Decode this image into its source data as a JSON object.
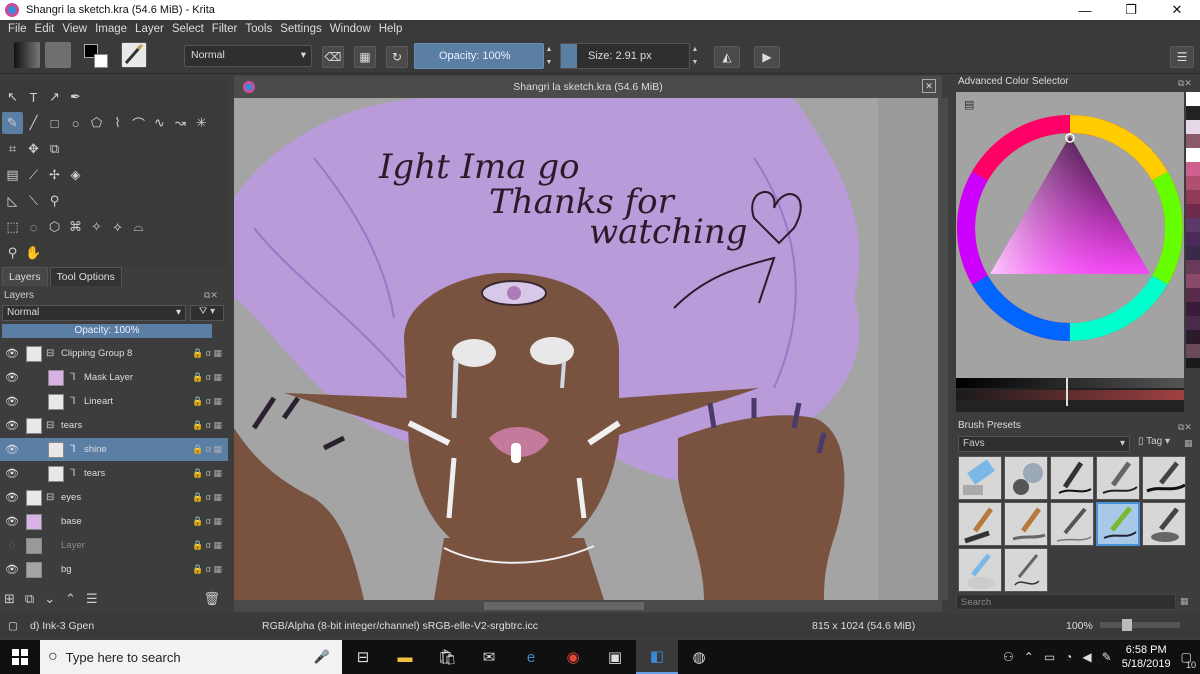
{
  "window": {
    "title": "Shangri la sketch.kra (54.6 MiB)  - Krita",
    "minimize": "—",
    "maximize": "❐",
    "close": "✕"
  },
  "menu": [
    "File",
    "Edit",
    "View",
    "Image",
    "Layer",
    "Select",
    "Filter",
    "Tools",
    "Settings",
    "Window",
    "Help"
  ],
  "toolbar": {
    "blend_mode": "Normal",
    "opacity_label": "Opacity:  100%",
    "size_label": "Size:  2.91 px"
  },
  "docker_tabs": [
    "Layers",
    "Tool Options"
  ],
  "layers": {
    "title": "Layers",
    "blend_mode": "Normal",
    "opacity_label": "Opacity:  100%",
    "items": [
      {
        "name": "Clipping Group 8",
        "visible": true,
        "selected": false,
        "dim": false
      },
      {
        "name": "Mask Layer",
        "visible": true,
        "selected": false,
        "dim": false
      },
      {
        "name": "Lineart",
        "visible": true,
        "selected": false,
        "dim": false
      },
      {
        "name": "tears",
        "visible": true,
        "selected": false,
        "dim": false
      },
      {
        "name": "shine",
        "visible": true,
        "selected": true,
        "dim": false
      },
      {
        "name": "tears",
        "visible": true,
        "selected": false,
        "dim": false
      },
      {
        "name": "eyes",
        "visible": true,
        "selected": false,
        "dim": false
      },
      {
        "name": "base",
        "visible": true,
        "selected": false,
        "dim": false
      },
      {
        "name": "Layer",
        "visible": false,
        "selected": false,
        "dim": true
      },
      {
        "name": "bg",
        "visible": true,
        "selected": false,
        "dim": false
      }
    ]
  },
  "canvas": {
    "title": "Shangri la sketch.kra (54.6 MiB)",
    "handwriting": [
      "Ight Ima go",
      "Thanks for",
      "watching"
    ]
  },
  "color_selector": {
    "title": "Advanced Color Selector"
  },
  "brush_presets": {
    "title": "Brush Presets",
    "tag": "Favs",
    "tag_button": "Tag",
    "search_placeholder": "Search"
  },
  "status": {
    "brush": "d) Ink-3 Gpen",
    "color_model": "RGB/Alpha (8-bit integer/channel)  sRGB-elle-V2-srgbtrc.icc",
    "dimensions": "815 x 1024 (54.6 MiB)",
    "zoom": "100%"
  },
  "taskbar": {
    "search_placeholder": "Type here to search",
    "time": "6:58 PM",
    "date": "5/18/2019",
    "notifications": "10"
  }
}
